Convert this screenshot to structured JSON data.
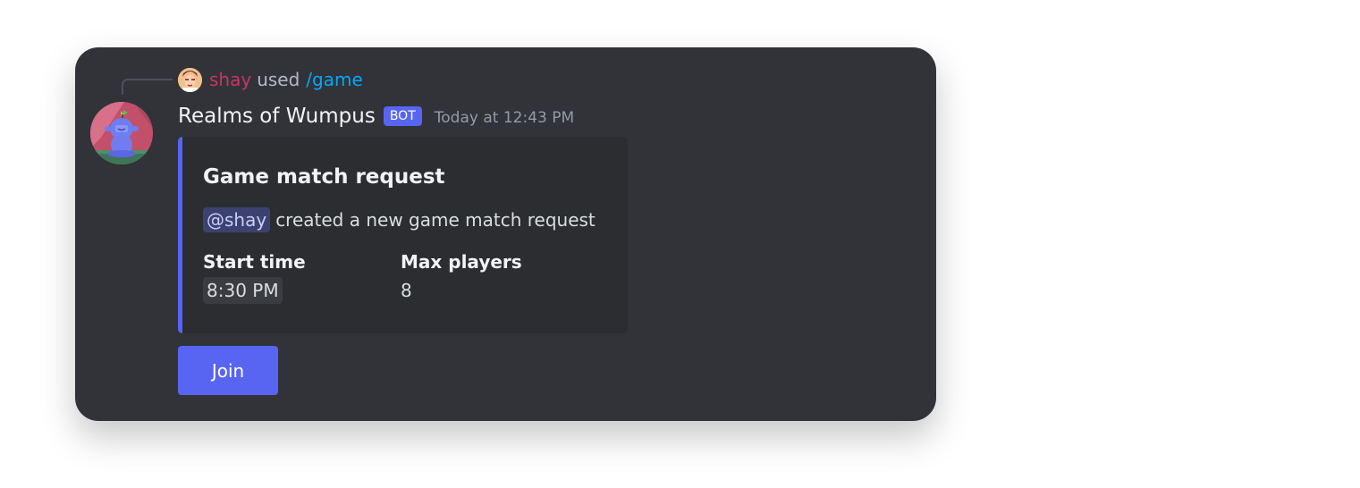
{
  "reply": {
    "username": "shay",
    "action": "used",
    "command": "/game"
  },
  "message": {
    "author": "Realms of Wumpus",
    "tag": "BOT",
    "timestamp": "Today at 12:43 PM"
  },
  "embed": {
    "title": "Game match request",
    "mention": "@shay",
    "description": "created a new game match request",
    "fields": [
      {
        "name": "Start time",
        "value": "8:30 PM"
      },
      {
        "name": "Max players",
        "value": "8"
      }
    ],
    "accent_color": "#5865f2"
  },
  "button": {
    "label": "Join"
  },
  "colors": {
    "card_bg": "#313338",
    "embed_bg": "#2b2d31",
    "blurple": "#5865f2",
    "username": "#c7365f",
    "command": "#00a8fc"
  }
}
